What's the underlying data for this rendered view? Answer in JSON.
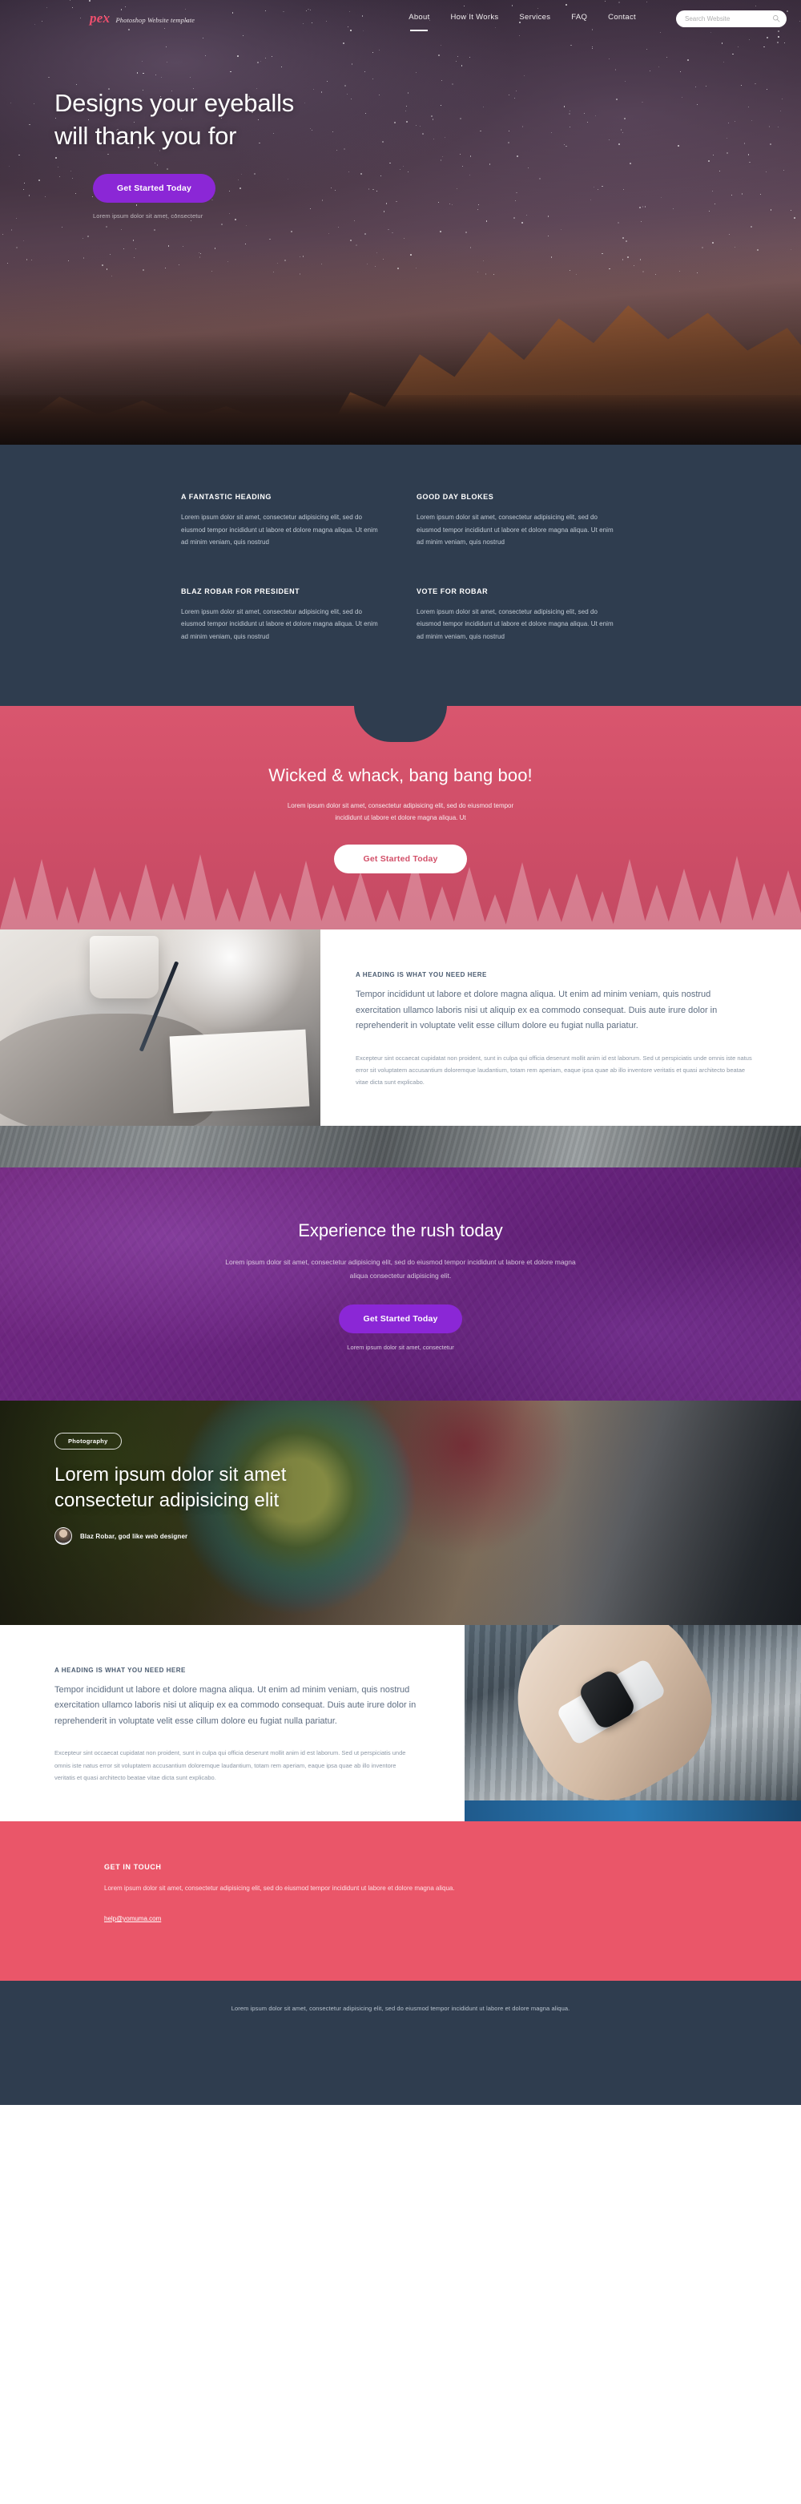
{
  "nav": {
    "logo": "pex",
    "logo_tagline": "Photoshop Website template",
    "links": [
      {
        "label": "About",
        "active": true
      },
      {
        "label": "How It Works",
        "active": false
      },
      {
        "label": "Services",
        "active": false
      },
      {
        "label": "FAQ",
        "active": false
      },
      {
        "label": "Contact",
        "active": false
      }
    ],
    "search_placeholder": "Search Website",
    "search_value": "",
    "search_icon": "search-icon"
  },
  "hero": {
    "title_line1": "Designs your eyeballs",
    "title_line2": "will thank you for",
    "cta_label": "Get Started Today",
    "note": "Lorem ipsum dolor sit amet, consectetur"
  },
  "features": [
    {
      "title": "A FANTASTIC HEADING",
      "body": "Lorem ipsum dolor sit amet, consectetur adipisicing elit, sed do eiusmod tempor incididunt ut labore et dolore magna aliqua. Ut enim ad minim veniam, quis nostrud"
    },
    {
      "title": "GOOD DAY BLOKES",
      "body": "Lorem ipsum dolor sit amet, consectetur adipisicing elit, sed do eiusmod tempor incididunt ut labore et dolore magna aliqua. Ut enim ad minim veniam, quis nostrud"
    },
    {
      "title": "BLAZ ROBAR FOR PRESIDENT",
      "body": "Lorem ipsum dolor sit amet, consectetur adipisicing elit, sed do eiusmod tempor incididunt ut labore et dolore magna aliqua. Ut enim ad minim veniam, quis nostrud"
    },
    {
      "title": "VOTE FOR ROBAR",
      "body": "Lorem ipsum dolor sit amet, consectetur adipisicing elit, sed do eiusmod tempor incididunt ut labore et dolore magna aliqua. Ut enim ad minim veniam, quis nostrud"
    }
  ],
  "pink_cta": {
    "title": "Wicked & whack, bang bang boo!",
    "subtitle": "Lorem ipsum dolor sit amet, consectetur adipisicing elit, sed do eiusmod tempor incididunt ut labore et dolore magna aliqua. Ut",
    "cta_label": "Get Started Today"
  },
  "content_block_1": {
    "kicker": "A HEADING IS WHAT YOU NEED HERE",
    "lead": "Tempor incididunt ut labore et dolore magna aliqua. Ut enim ad minim veniam, quis nostrud exercitation ullamco laboris nisi ut aliquip ex ea commodo consequat. Duis aute irure dolor in reprehenderit in voluptate velit esse cillum dolore eu fugiat nulla pariatur.",
    "small": "Excepteur sint occaecat cupidatat non proident, sunt in culpa qui officia deserunt mollit anim id est laborum. Sed ut perspiciatis unde omnis iste natus error sit voluptatem accusantium doloremque laudantium, totam rem aperiam, eaque ipsa quae ab illo inventore veritatis et quasi architecto beatae vitae dicta sunt explicabo."
  },
  "purple_cta": {
    "title": "Experience the rush today",
    "subtitle": "Lorem ipsum dolor sit amet, consectetur adipisicing elit, sed do eiusmod tempor incididunt ut labore et dolore magna aliqua consectetur adipisicing elit.",
    "cta_label": "Get Started Today",
    "note": "Lorem ipsum dolor sit amet, consectetur"
  },
  "food_hero": {
    "badge": "Photography",
    "title_line1": "Lorem ipsum dolor sit amet",
    "title_line2": "consectetur adipisicing elit",
    "author": "Blaz Robar, god like web designer"
  },
  "content_block_2": {
    "kicker": "A HEADING IS WHAT YOU NEED HERE",
    "lead": "Tempor incididunt ut labore et dolore magna aliqua. Ut enim ad minim veniam, quis nostrud exercitation ullamco laboris nisi ut aliquip ex ea commodo consequat. Duis aute irure dolor in reprehenderit in voluptate velit esse cillum dolore eu fugiat nulla pariatur.",
    "small": "Excepteur sint occaecat cupidatat non proident, sunt in culpa qui officia deserunt mollit anim id est laborum. Sed ut perspiciatis unde omnis iste natus error sit voluptatem accusantium doloremque laudantium, totam rem aperiam, eaque ipsa quae ab illo inventore veritatis et quasi architecto beatae vitae dicta sunt explicabo."
  },
  "contact": {
    "title": "GET IN TOUCH",
    "body": "Lorem ipsum dolor sit amet, consectetur adipisicing elit, sed do eiusmod tempor incididunt ut labore et dolore magna aliqua.",
    "email": "help@yomuma.com"
  },
  "footer": {
    "text": "Lorem ipsum dolor sit amet, consectetur adipisicing elit, sed do eiusmod tempor incididunt ut labore et dolore magna aliqua."
  },
  "colors": {
    "purple_accent": "#8b27d6",
    "pink_accent": "#ea5669",
    "dark_slate": "#2f3d4f",
    "logo_pink": "#ef4f6e"
  }
}
